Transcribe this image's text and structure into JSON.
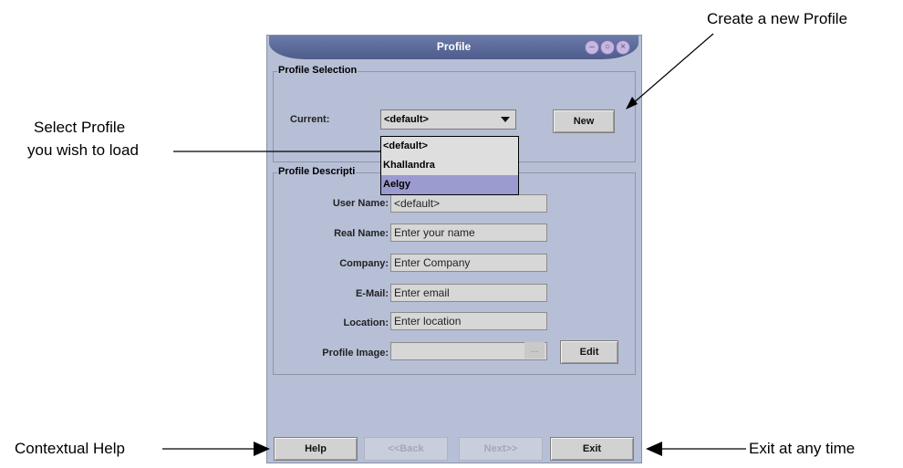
{
  "annotations": {
    "create_profile": "Create a new Profile",
    "select_profile_line1": "Select Profile",
    "select_profile_line2": "you wish to load",
    "contextual_help": "Contextual Help",
    "exit_any_time": "Exit at any time"
  },
  "window": {
    "title": "Profile",
    "controls": [
      "minimize-icon",
      "maximize-icon",
      "close-icon"
    ]
  },
  "profile_selection": {
    "group_title": "Profile Selection",
    "current_label": "Current:",
    "current_value": "<default>",
    "new_button": "New",
    "dropdown_items": [
      "<default>",
      "Khallandra",
      "Aelgy"
    ],
    "selected_index": 2
  },
  "profile_description": {
    "group_title": "Profile Descripti",
    "user_name_label": "User Name:",
    "user_name_value": "<default>",
    "real_name_label": "Real Name:",
    "real_name_value": "Enter your name",
    "company_label": "Company:",
    "company_value": "Enter Company",
    "email_label": "E-Mail:",
    "email_value": "Enter email",
    "location_label": "Location:",
    "location_value": "Enter location",
    "image_label": "Profile Image:",
    "image_value": "",
    "ellipsis": "...",
    "edit_button": "Edit"
  },
  "footer": {
    "help": "Help",
    "back": "<<Back",
    "next": "Next>>",
    "exit": "Exit"
  }
}
